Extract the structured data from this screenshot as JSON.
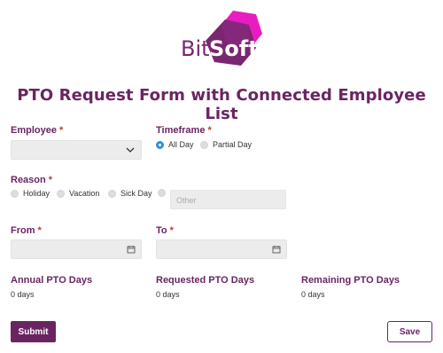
{
  "brand": {
    "logo_part1": "Bit",
    "logo_part2": "Soft",
    "primary_color": "#6b2462",
    "accent_color": "#e81cc0"
  },
  "form": {
    "title": "PTO Request Form with Connected Employee List"
  },
  "employee": {
    "label": "Employee",
    "required_mark": "*",
    "value": ""
  },
  "timeframe": {
    "label": "Timeframe",
    "required_mark": "*",
    "options": [
      {
        "label": "All Day",
        "checked": true
      },
      {
        "label": "Partial Day",
        "checked": false
      }
    ]
  },
  "reason": {
    "label": "Reason",
    "required_mark": "*",
    "options": [
      {
        "label": "Holiday",
        "checked": false
      },
      {
        "label": "Vacation",
        "checked": false
      },
      {
        "label": "Sick Day",
        "checked": false
      }
    ],
    "other_placeholder": "Other"
  },
  "from": {
    "label": "From",
    "required_mark": "*",
    "value": ""
  },
  "to": {
    "label": "To",
    "required_mark": "*",
    "value": ""
  },
  "pto": {
    "annual_label": "Annual PTO Days",
    "annual_value": "0 days",
    "requested_label": "Requested PTO Days",
    "requested_value": "0 days",
    "remaining_label": "Remaining PTO Days",
    "remaining_value": "0 days"
  },
  "actions": {
    "submit_label": "Submit",
    "save_label": "Save"
  }
}
